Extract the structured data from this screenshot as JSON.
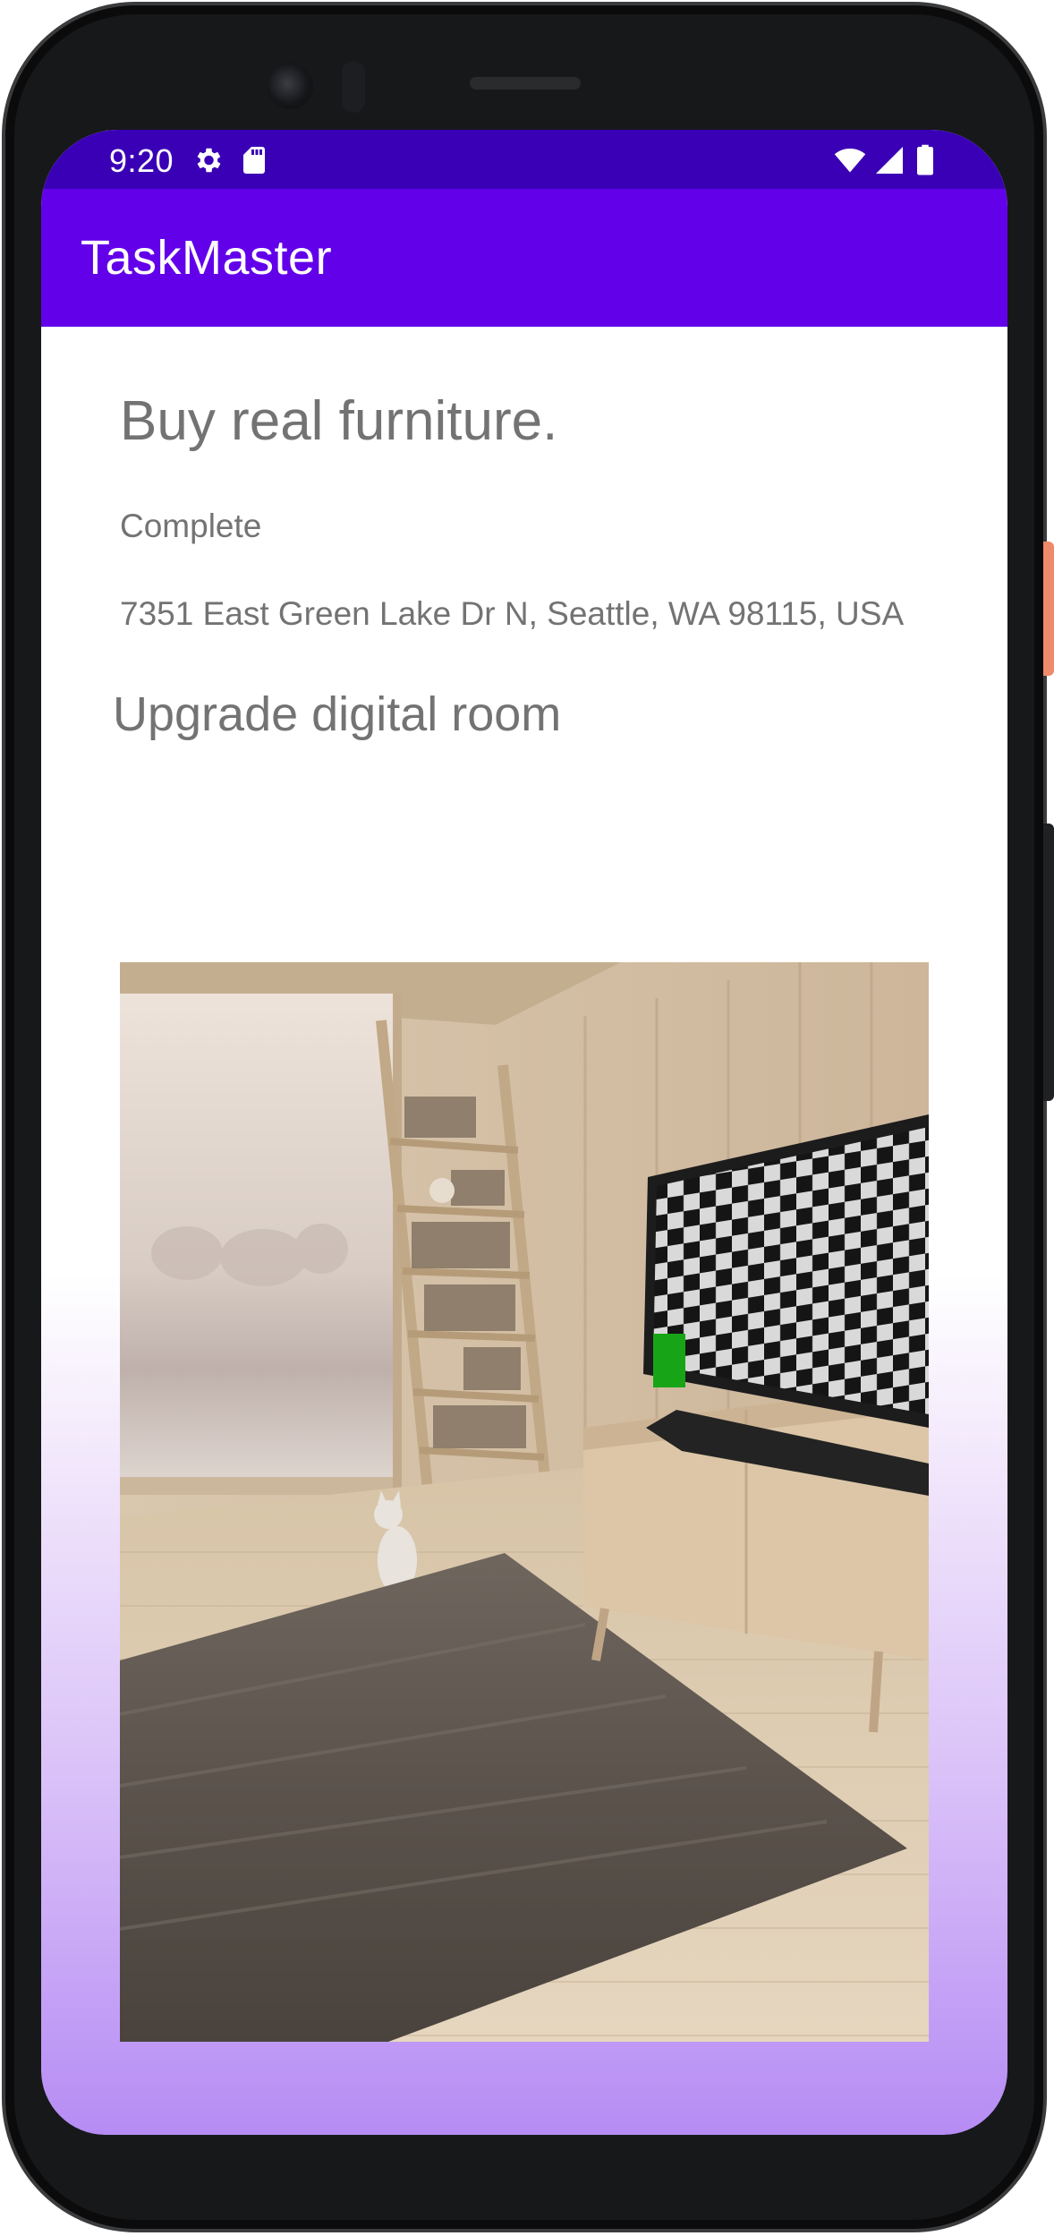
{
  "status_bar": {
    "time": "9:20",
    "icons": [
      "gear-icon",
      "sd-card-icon",
      "wifi-icon",
      "signal-icon",
      "battery-icon"
    ]
  },
  "app_bar": {
    "title": "TaskMaster"
  },
  "task": {
    "title": "Buy real furniture.",
    "state": "Complete",
    "address": "7351 East Green Lake Dr N, Seattle, WA 98115, USA",
    "description": "Upgrade digital room",
    "image": "room-photo"
  },
  "colors": {
    "status_bar": "#3a00b5",
    "app_bar": "#6200ea",
    "text_secondary": "#737373"
  }
}
